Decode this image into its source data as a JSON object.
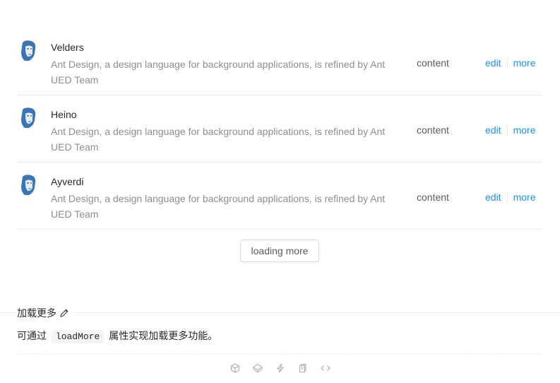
{
  "list": {
    "items": [
      {
        "title": "Velders",
        "description": "Ant Design, a design language for background applications, is refined by Ant UED Team",
        "content": "content",
        "edit_label": "edit",
        "more_label": "more"
      },
      {
        "title": "Heino",
        "description": "Ant Design, a design language for background applications, is refined by Ant UED Team",
        "content": "content",
        "edit_label": "edit",
        "more_label": "more"
      },
      {
        "title": "Ayverdi",
        "description": "Ant Design, a design language for background applications, is refined by Ant UED Team",
        "content": "content",
        "edit_label": "edit",
        "more_label": "more"
      }
    ],
    "load_more_label": "loading more"
  },
  "demo_meta": {
    "title": "加载更多",
    "desc_before": "可通过",
    "desc_code": "loadMore",
    "desc_after": "属性实现加载更多功能。"
  },
  "code_actions": [
    "codesandbox-icon",
    "codepen-icon",
    "riddle-icon",
    "copy-icon",
    "code-expand-icon"
  ],
  "colors": {
    "link": "#1890ff",
    "border": "#e8e8e8",
    "avatar": "#3a75b8"
  }
}
